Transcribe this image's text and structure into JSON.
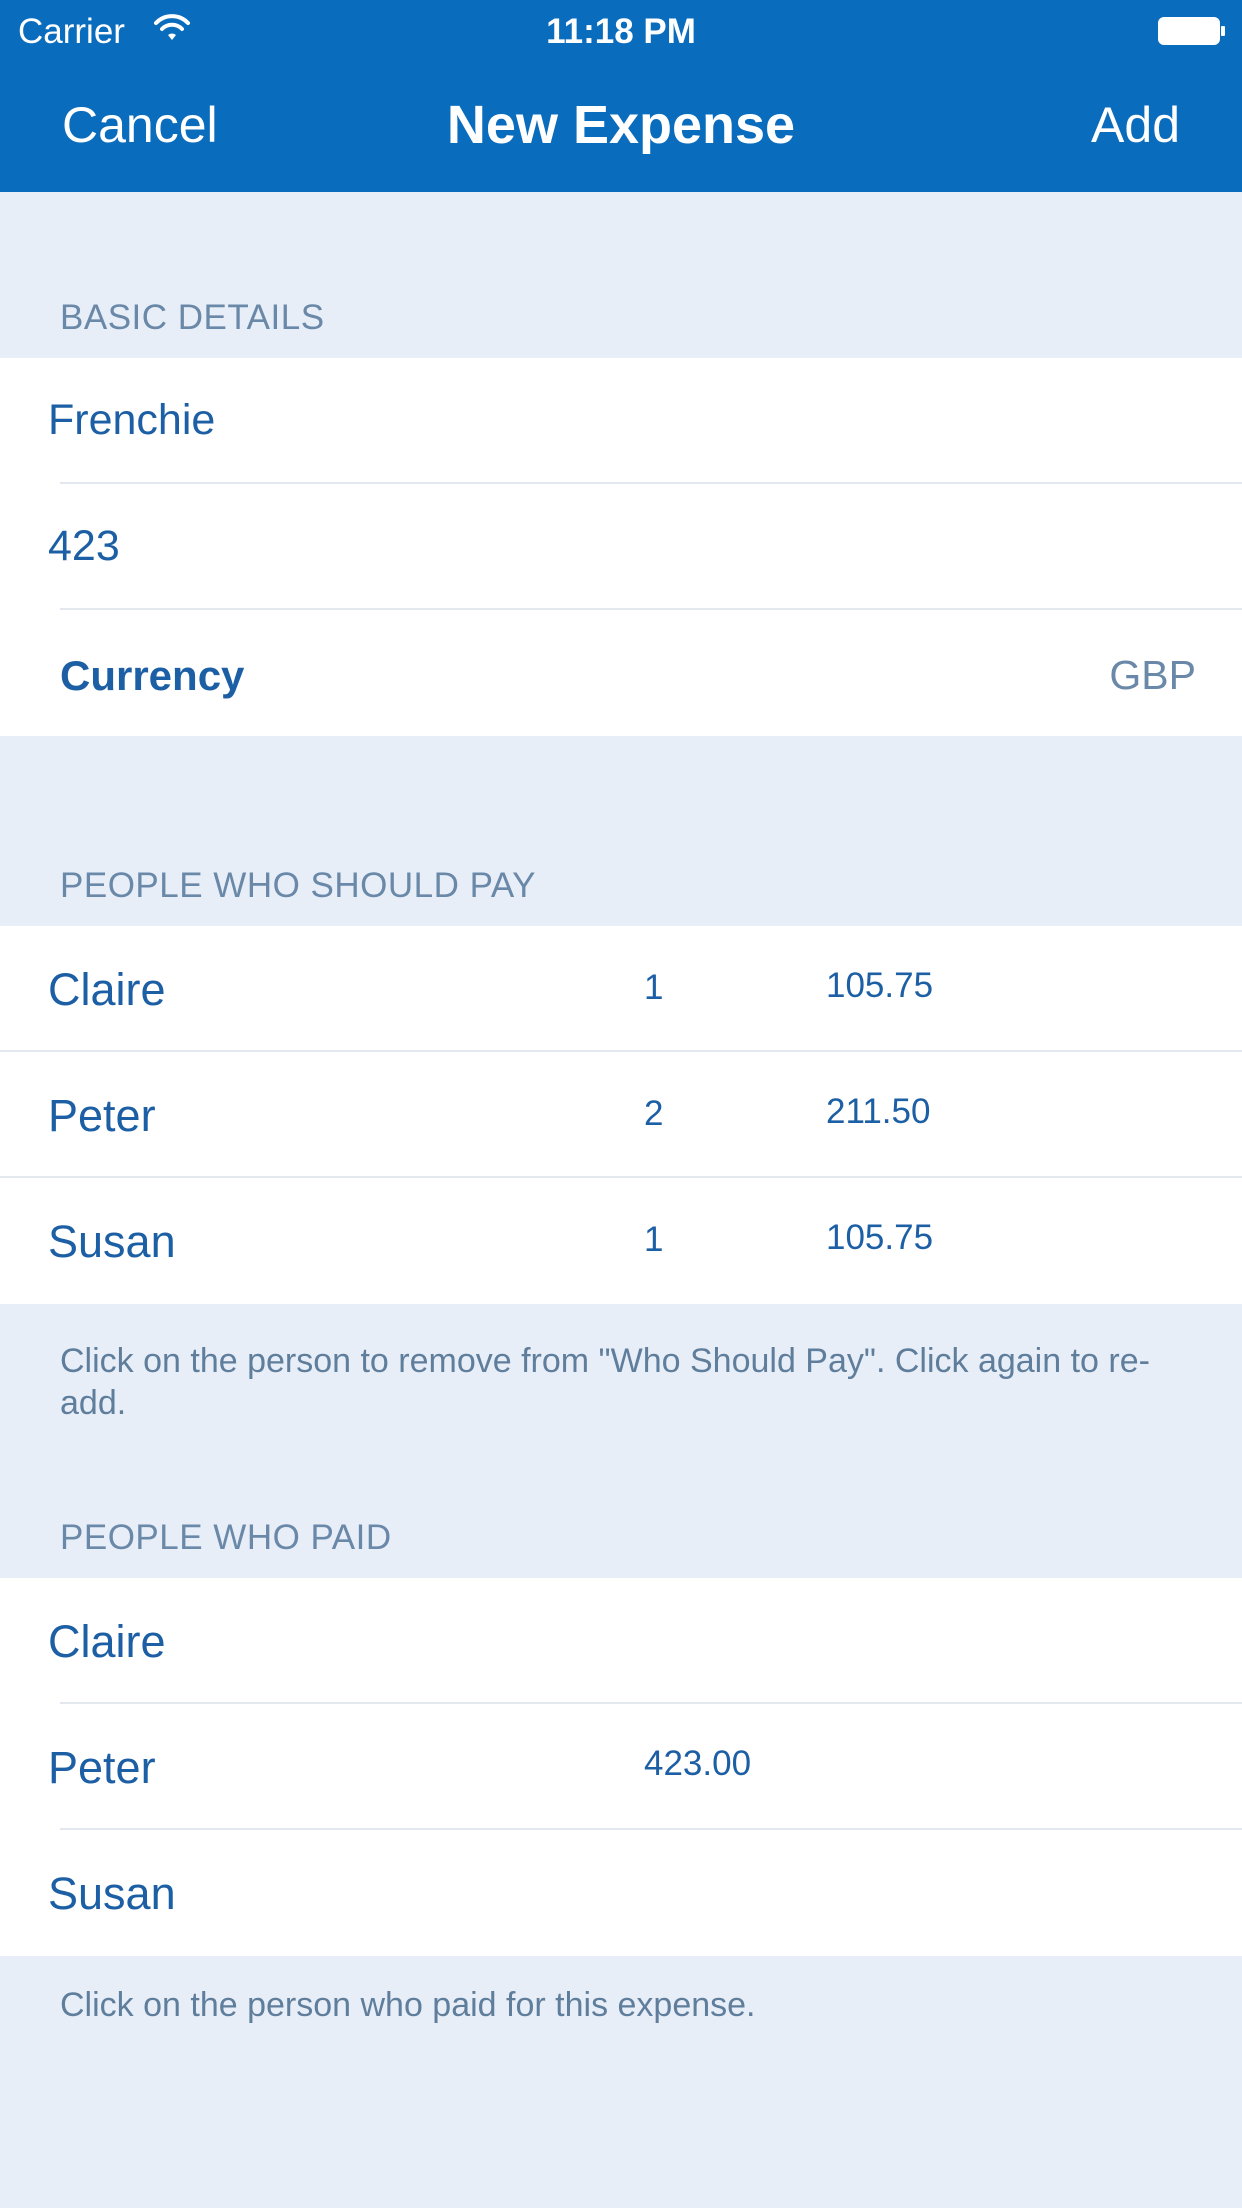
{
  "status_bar": {
    "carrier": "Carrier",
    "time": "11:18 PM"
  },
  "nav": {
    "cancel_label": "Cancel",
    "title": "New Expense",
    "add_label": "Add"
  },
  "basic_details": {
    "header": "BASIC DETAILS",
    "name_value": "Frenchie",
    "amount_value": "423",
    "currency_label": "Currency",
    "currency_value": "GBP"
  },
  "should_pay": {
    "header": "PEOPLE WHO SHOULD PAY",
    "people": [
      {
        "name": "Claire",
        "shares": "1",
        "amount": "105.75"
      },
      {
        "name": "Peter",
        "shares": "2",
        "amount": "211.50"
      },
      {
        "name": "Susan",
        "shares": "1",
        "amount": "105.75"
      }
    ],
    "footer": "Click on the person to remove from \"Who Should Pay\". Click again to re-add."
  },
  "who_paid": {
    "header": "PEOPLE WHO PAID",
    "people": [
      {
        "name": "Claire",
        "amount": ""
      },
      {
        "name": "Peter",
        "amount": "423.00"
      },
      {
        "name": "Susan",
        "amount": ""
      }
    ],
    "footer": "Click on the person who paid for this expense."
  },
  "colors": {
    "nav_background": "#0a6cbd",
    "page_background": "#e8eef8",
    "text_blue": "#1d5fa4",
    "muted_text": "#6a88a8"
  }
}
